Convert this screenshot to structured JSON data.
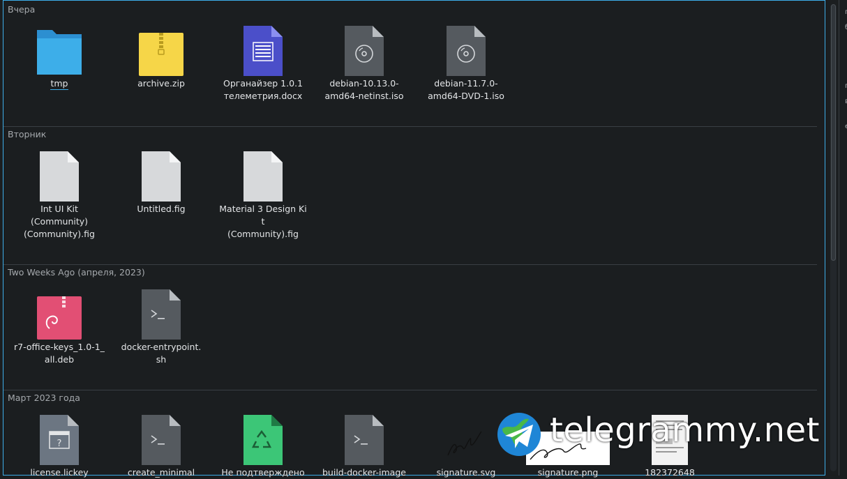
{
  "groups": [
    {
      "header": "Вчера",
      "items": [
        {
          "label": "tmp",
          "icon": "folder-icon"
        },
        {
          "label": "archive.zip",
          "icon": "zip-archive-icon"
        },
        {
          "label": "Органайзер 1.0.1\nтелеметрия.docx",
          "icon": "document-icon"
        },
        {
          "label": "debian-10.13.0-\namd64-netinst.iso",
          "icon": "disc-image-icon"
        },
        {
          "label": "debian-11.7.0-\namd64-DVD-1.iso",
          "icon": "disc-image-icon"
        }
      ]
    },
    {
      "header": "Вторник",
      "items": [
        {
          "label": "Int UI Kit\n(Community)\n(Community).fig",
          "icon": "blank-file-icon"
        },
        {
          "label": "Untitled.fig",
          "icon": "blank-file-icon"
        },
        {
          "label": "Material 3 Design Kit\n(Community).fig",
          "icon": "blank-file-icon"
        }
      ]
    },
    {
      "header": "Two Weeks Ago (апреля, 2023)",
      "items": [
        {
          "label": "r7-office-keys_1.0-1_\nall.deb",
          "icon": "debian-package-icon"
        },
        {
          "label": "docker-entrypoint.\nsh",
          "icon": "shell-script-icon"
        }
      ]
    },
    {
      "header": "Март 2023 года",
      "items": [
        {
          "label": "license.lickey",
          "icon": "unknown-file-icon"
        },
        {
          "label": "create_minimal",
          "icon": "shell-script-icon"
        },
        {
          "label": "Не подтверждено",
          "icon": "recycle-file-icon"
        },
        {
          "label": "build-docker-image",
          "icon": "shell-script-icon"
        },
        {
          "label": "signature.svg",
          "icon": "signature-thumbnail-icon"
        },
        {
          "label": "signature.png",
          "icon": "signature-thumbnail-icon"
        },
        {
          "label": "182372648",
          "icon": "document-thumbnail-icon"
        }
      ]
    }
  ],
  "side_panel_chars": [
    "п",
    "б",
    "п",
    "в",
    "е"
  ],
  "watermark": {
    "text": "telegrammy.net"
  },
  "colors": {
    "accent": "#3daee9",
    "background": "#1b1e20",
    "folder": "#3a9ee0",
    "zip": "#f6d648",
    "docx": "#4b4fc9",
    "deb": "#e24f74",
    "recycle": "#3cc677"
  }
}
